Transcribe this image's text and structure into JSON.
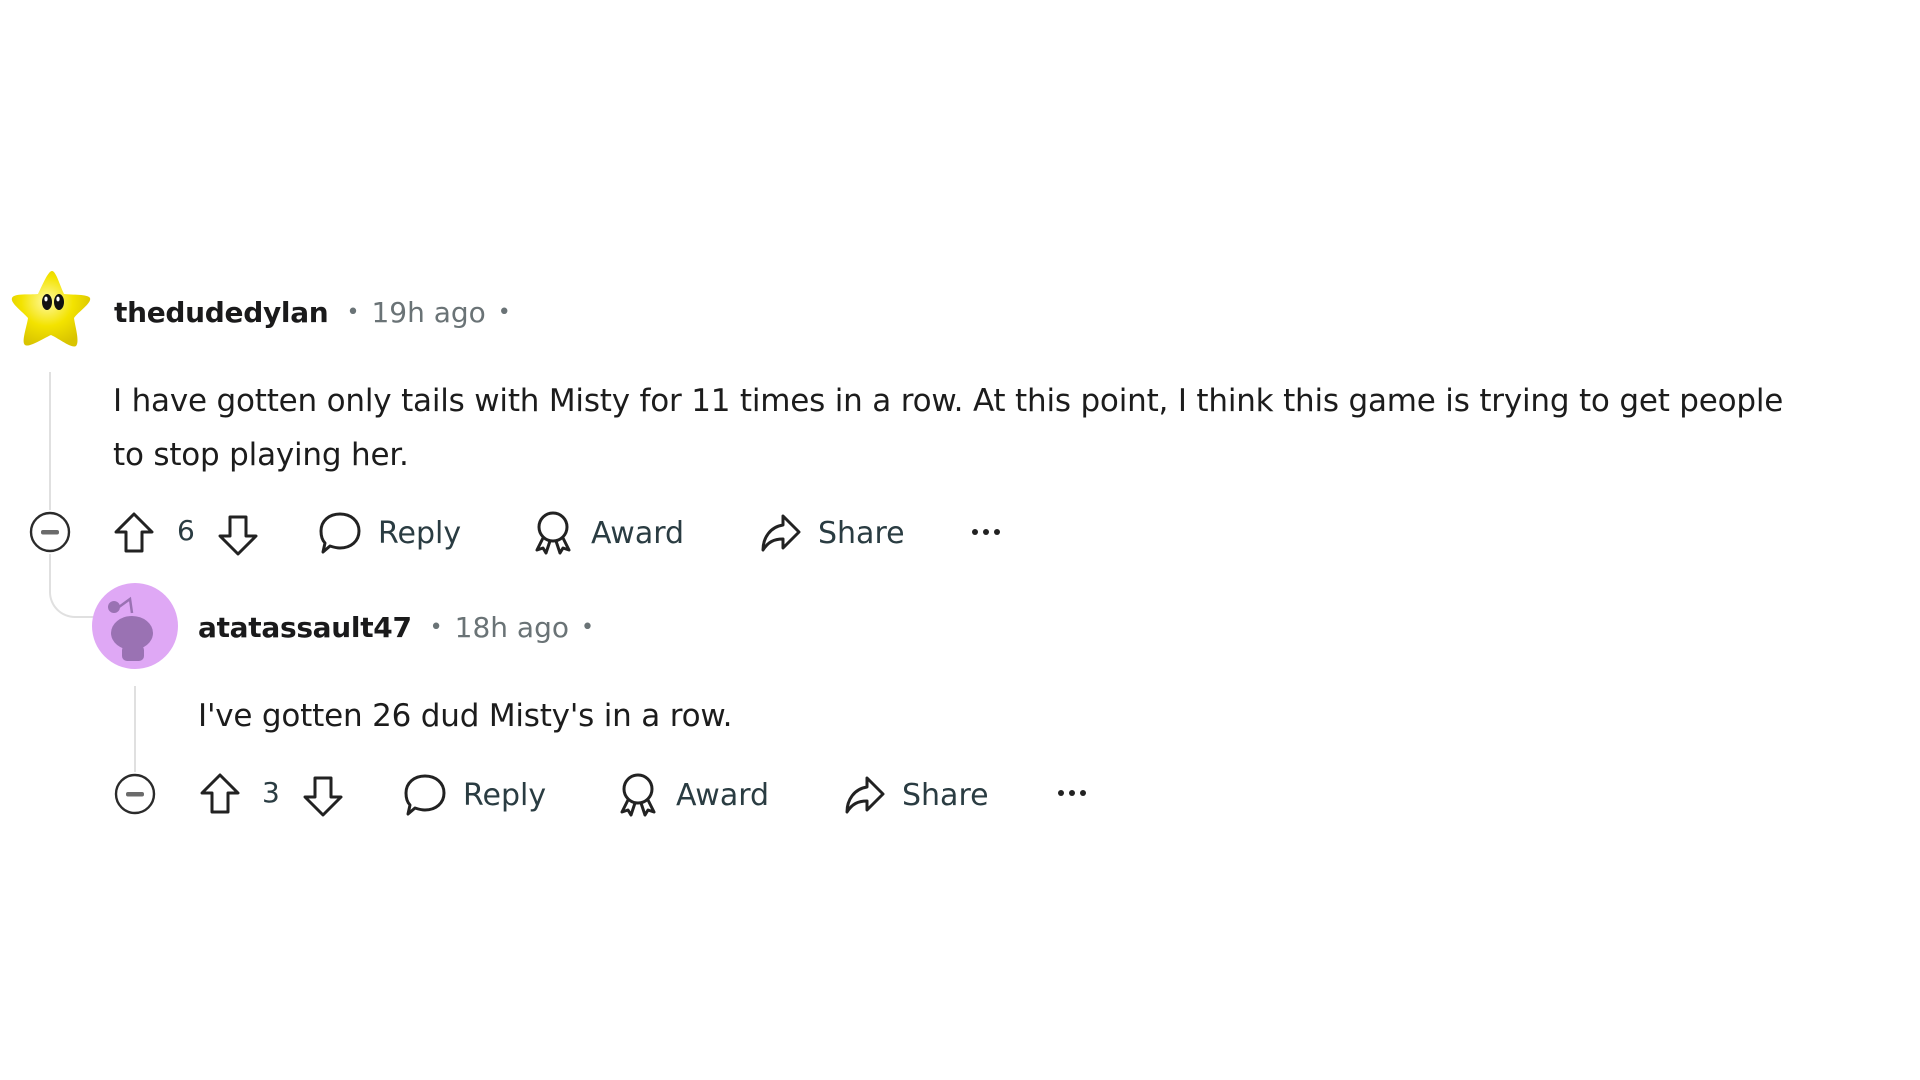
{
  "comments": [
    {
      "username": "thedudedylan",
      "timestamp": "19h ago",
      "avatar_icon": "yellow-star-avatar",
      "body": "I have gotten only tails with Misty for 11 times in a row. At this point, I think this game is trying to get people to stop playing her.",
      "body_lines": [
        "I have gotten only tails with Misty for 11 times in a row. At this point, I think this game is trying to get people",
        "to stop playing her."
      ],
      "score": "6",
      "actions": {
        "reply": "Reply",
        "award": "Award",
        "share": "Share",
        "more": "..."
      }
    },
    {
      "username": "atatassault47",
      "timestamp": "18h ago",
      "avatar_icon": "snoo-avatar",
      "avatar_color": "#dfa8f5",
      "body": "I've gotten 26 dud Misty's in a row.",
      "score": "3",
      "actions": {
        "reply": "Reply",
        "award": "Award",
        "share": "Share",
        "more": "..."
      }
    }
  ],
  "separator": "•",
  "colors": {
    "text": "#1c1c1c",
    "meta": "#6a7376",
    "thread_line": "#e0e0e0",
    "star": "#f5e400",
    "snoo": "#9a72b3"
  }
}
